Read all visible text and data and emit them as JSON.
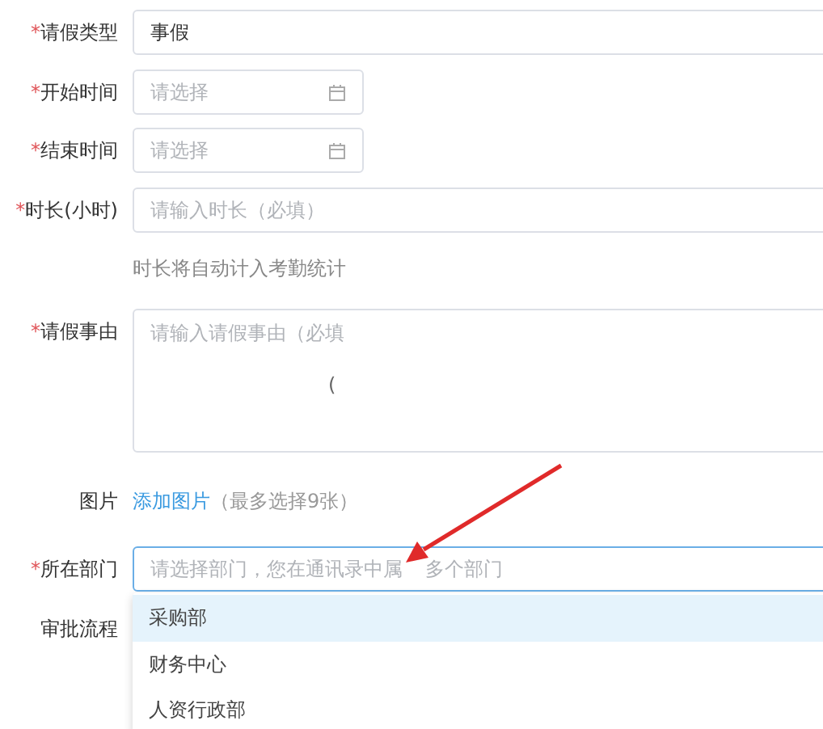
{
  "fields": [
    {
      "kind": "select",
      "label": "请假类型",
      "mark": "*",
      "value": "事假"
    },
    {
      "kind": "date",
      "label": "开始时间",
      "mark": "*",
      "placeholder": "请选择"
    },
    {
      "kind": "date",
      "label": "结束时间",
      "mark": "*",
      "placeholder": "请选择"
    },
    {
      "kind": "text",
      "label": "时长(小时)",
      "mark": "*",
      "placeholder": "请输入时长（必填）",
      "hint": "时长将自动计入考勤统计"
    },
    {
      "kind": "textarea",
      "label": "请假事由",
      "mark": "*",
      "placeholder": "请输入请假事由（必填",
      "stray_text": "("
    },
    {
      "kind": "upload",
      "label": "图片",
      "link": "添加图片",
      "note": "（最多选择9张）"
    },
    {
      "kind": "dropdown",
      "label": "所在部门",
      "mark": "*",
      "placeholder": "请选择部门，您在通讯录中属",
      "placeholder_rest": "多个部门",
      "focused": true,
      "options": [
        {
          "label": "采购部",
          "selected": true
        },
        {
          "label": "财务中心",
          "selected": false
        },
        {
          "label": "人资行政部",
          "selected": false
        }
      ]
    },
    {
      "kind": "plain",
      "label": "审批流程"
    }
  ]
}
